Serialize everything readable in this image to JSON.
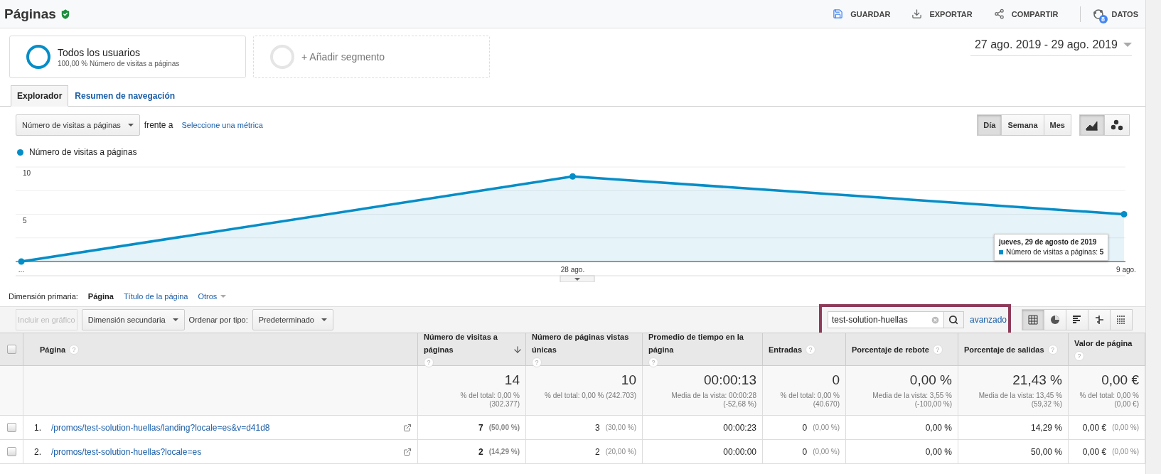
{
  "header": {
    "title": "Páginas",
    "actions": [
      {
        "kind": "save",
        "label": "GUARDAR"
      },
      {
        "kind": "export",
        "label": "EXPORTAR"
      },
      {
        "kind": "share",
        "label": "COMPARTIR"
      },
      {
        "kind": "data",
        "label": "DATOS",
        "badge": "8"
      }
    ]
  },
  "segments": [
    {
      "kind": "active",
      "title": "Todos los usuarios",
      "subtitle": "100,00 % Número de visitas a páginas"
    },
    {
      "kind": "add",
      "title": "+ Añadir segmento"
    }
  ],
  "date_range": "27 ago. 2019 - 29 ago. 2019",
  "tabs": [
    {
      "label": "Explorador",
      "selected": true
    },
    {
      "label": "Resumen de navegación",
      "selected": false
    }
  ],
  "metric_select": "Número de visitas a páginas",
  "versus_label": "frente a",
  "second_metric_link": "Seleccione una métrica",
  "granularity": [
    {
      "label": "Día",
      "selected": true
    },
    {
      "label": "Semana",
      "selected": false
    },
    {
      "label": "Mes",
      "selected": false
    }
  ],
  "chart_types": [
    {
      "kind": "line",
      "selected": true
    },
    {
      "kind": "motion",
      "selected": false
    }
  ],
  "chart": {
    "chart_data": {
      "type": "area",
      "categories": [
        "...",
        "28 ago.",
        "9 ago."
      ],
      "ylim": [
        0,
        10
      ],
      "yticks": [
        5,
        10
      ],
      "series": [
        {
          "name": "Número de visitas a páginas",
          "color": "#058dc7",
          "marker": "circle",
          "values": [
            0,
            9,
            5
          ]
        }
      ]
    },
    "tooltip": {
      "title": "jueves, 29 de agosto de 2019",
      "line": "Número de visitas a páginas: **5**"
    }
  },
  "primary_dimension": {
    "label": "Dimensión primaria:",
    "options": [
      {
        "label": "Página",
        "selected": true
      },
      {
        "label": "Título de la página",
        "selected": false
      },
      {
        "label": "Otros",
        "selected": false
      }
    ]
  },
  "toolbar": {
    "include_button": {
      "label": "Incluir en gráfico",
      "disabled": true
    },
    "secondary_dimension": "Dimensión secundaria",
    "sort_label": "Ordenar por tipo:",
    "sort_value": "Predeterminado",
    "search": {
      "value": "test-solution-huellas",
      "highlighted": true
    },
    "advanced_link": "avanzado",
    "views": [
      {
        "kind": "table",
        "selected": true
      },
      {
        "kind": "pie",
        "selected": false
      },
      {
        "kind": "bars",
        "selected": false
      },
      {
        "kind": "compare",
        "selected": false
      },
      {
        "kind": "pivot",
        "selected": false
      }
    ]
  },
  "table": {
    "select_all": {
      "checked": false
    },
    "columns": [
      {
        "label": "Página",
        "help": "?",
        "sorted": false
      },
      {
        "label": "Número de visitas a páginas",
        "help": "?",
        "sorted": true
      },
      {
        "label": "Número de páginas vistas únicas",
        "help": "?",
        "sorted": false
      },
      {
        "label": "Promedio de tiempo en la página",
        "help": "?",
        "sorted": false
      },
      {
        "label": "Entradas",
        "help": "?",
        "sorted": false
      },
      {
        "label": "Porcentaje de rebote",
        "help": "?",
        "sorted": false
      },
      {
        "label": "Porcentaje de salidas",
        "help": "?",
        "sorted": false
      },
      {
        "label": "Valor de página",
        "help": "?",
        "sorted": false
      }
    ],
    "totals": [
      {
        "value": "14",
        "lines": [
          "% del total: 0,00 %",
          "(302.377)"
        ]
      },
      {
        "value": "10",
        "lines": [
          "% del total: 0,00 % (242.703)"
        ]
      },
      {
        "value": "00:00:13",
        "lines": [
          "Media de la vista: 00:00:28",
          "(-52,68 %)"
        ]
      },
      {
        "value": "0",
        "lines": [
          "% del total: 0,00 %",
          "(40.670)"
        ]
      },
      {
        "value": "0,00 %",
        "lines": [
          "Media de la vista: 3,55 %",
          "(-100,00 %)"
        ]
      },
      {
        "value": "21,43 %",
        "lines": [
          "Media de la vista: 13,45 %",
          "(59,32 %)"
        ]
      },
      {
        "value": "0,00 €",
        "lines": [
          "% del total: 0,00 %",
          "(0,00 €)"
        ]
      }
    ],
    "rows": [
      {
        "checked": false,
        "cells": [
          {
            "kind": "page",
            "index": "1.",
            "value": "/promos/test-solution-huellas/landing?locale=es&v=d41d8"
          },
          {
            "kind": "metric",
            "value": "7",
            "share": "(50,00 %)",
            "bold": true
          },
          {
            "kind": "metric",
            "value": "3",
            "share": "(30,00 %)",
            "bold": false
          },
          {
            "kind": "metric",
            "value": "00:00:23",
            "bold": false
          },
          {
            "kind": "metric",
            "value": "0",
            "share": "(0,00 %)",
            "bold": false
          },
          {
            "kind": "metric",
            "value": "0,00 %",
            "bold": false
          },
          {
            "kind": "metric",
            "value": "14,29 %",
            "bold": false
          },
          {
            "kind": "metric",
            "value": "0,00 €",
            "share": "(0,00 %)",
            "bold": false
          }
        ]
      },
      {
        "checked": false,
        "cells": [
          {
            "kind": "page",
            "index": "2.",
            "value": "/promos/test-solution-huellas?locale=es"
          },
          {
            "kind": "metric",
            "value": "2",
            "share": "(14,29 %)",
            "bold": true
          },
          {
            "kind": "metric",
            "value": "2",
            "share": "(20,00 %)",
            "bold": false
          },
          {
            "kind": "metric",
            "value": "00:00:00",
            "bold": false
          },
          {
            "kind": "metric",
            "value": "0",
            "share": "(0,00 %)",
            "bold": false
          },
          {
            "kind": "metric",
            "value": "0,00 %",
            "bold": false
          },
          {
            "kind": "metric",
            "value": "50,00 %",
            "bold": false
          },
          {
            "kind": "metric",
            "value": "0,00 €",
            "share": "(0,00 %)",
            "bold": false
          }
        ]
      }
    ]
  }
}
